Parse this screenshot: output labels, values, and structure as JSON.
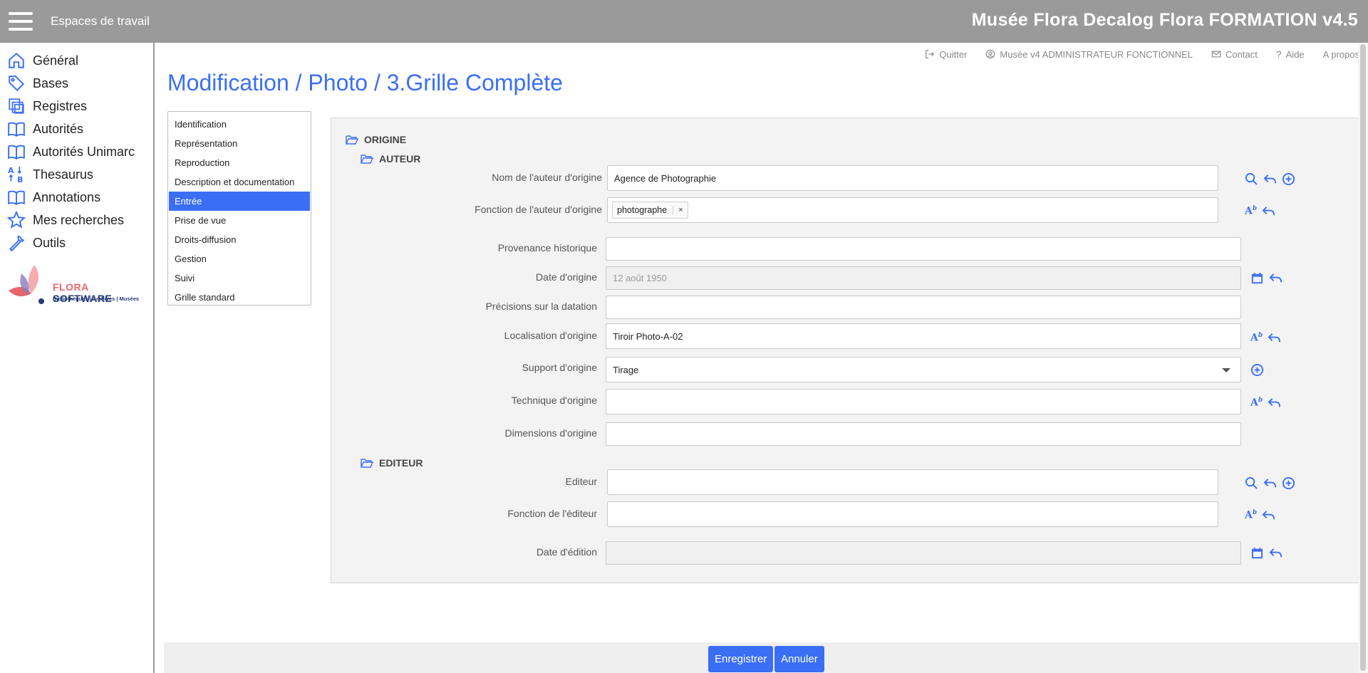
{
  "topbar": {
    "menu_icon": "hamburger-icon",
    "workspaces": "Espaces de travail",
    "title": "Musée Flora Decalog Flora FORMATION v4.5"
  },
  "sidebar": {
    "items": [
      {
        "label": "Général",
        "icon": "home-icon"
      },
      {
        "label": "Bases",
        "icon": "tag-icon"
      },
      {
        "label": "Registres",
        "icon": "copy-icon"
      },
      {
        "label": "Autorités",
        "icon": "book-icon"
      },
      {
        "label": "Autorités Unimarc",
        "icon": "book-icon"
      },
      {
        "label": "Thesaurus",
        "icon": "sort-alpha-icon"
      },
      {
        "label": "Annotations",
        "icon": "book-icon"
      },
      {
        "label": "Mes recherches",
        "icon": "star-icon"
      },
      {
        "label": "Outils",
        "icon": "wrench-icon"
      }
    ],
    "logo": {
      "brand_part1": "FLORA",
      "brand_part2": "SOFTWARE",
      "subtitle": "Bibliothèques | Archives | Musées"
    }
  },
  "toplinks": {
    "quit": "Quitter",
    "user": "Musée v4 ADMINISTRATEUR FONCTIONNEL",
    "contact": "Contact",
    "help": "Aide",
    "about": "A propos"
  },
  "page_title": "Modification / Photo / 3.Grille Complète",
  "tabs": [
    {
      "label": "Identification",
      "active": false
    },
    {
      "label": "Représentation",
      "active": false
    },
    {
      "label": "Reproduction",
      "active": false
    },
    {
      "label": "Description et documentation",
      "active": false
    },
    {
      "label": "Entrée",
      "active": true
    },
    {
      "label": "Prise de vue",
      "active": false
    },
    {
      "label": "Droits-diffusion",
      "active": false
    },
    {
      "label": "Gestion",
      "active": false
    },
    {
      "label": "Suivi",
      "active": false
    },
    {
      "label": "Grille standard",
      "active": false
    }
  ],
  "form": {
    "section_origine": "ORIGINE",
    "section_auteur": "AUTEUR",
    "section_editeur": "EDITEUR",
    "fields": {
      "nom_auteur": {
        "label": "Nom de l'auteur d'origine",
        "value": "Agence de Photographie"
      },
      "fonction_auteur": {
        "label": "Fonction de l'auteur d'origine",
        "chip": "photographe",
        "chip_remove": "×"
      },
      "provenance": {
        "label": "Provenance historique",
        "value": ""
      },
      "date_origine": {
        "label": "Date d'origine",
        "value": "12 août 1950"
      },
      "precisions": {
        "label": "Précisions sur la datation",
        "value": ""
      },
      "localisation": {
        "label": "Localisation d'origine",
        "value": "Tiroir Photo-A-02"
      },
      "support": {
        "label": "Support d'origine",
        "value": "Tirage"
      },
      "technique": {
        "label": "Technique d'origine",
        "value": ""
      },
      "dimensions": {
        "label": "Dimensions d'origine",
        "value": ""
      },
      "editeur": {
        "label": "Editeur",
        "value": ""
      },
      "fonction_editeur": {
        "label": "Fonction de l'éditeur",
        "value": ""
      },
      "date_edition": {
        "label": "Date d'édition",
        "value": ""
      }
    },
    "icon_ab_text": "A",
    "icon_ab_sup": "b"
  },
  "actions": {
    "save": "Enregistrer",
    "cancel": "Annuler"
  },
  "colors": {
    "accent": "#3a6ff5",
    "topbar": "#9a9a9a",
    "panel": "#f3f3f3",
    "logo_pink": "#e8656a",
    "logo_navy": "#243a78"
  }
}
